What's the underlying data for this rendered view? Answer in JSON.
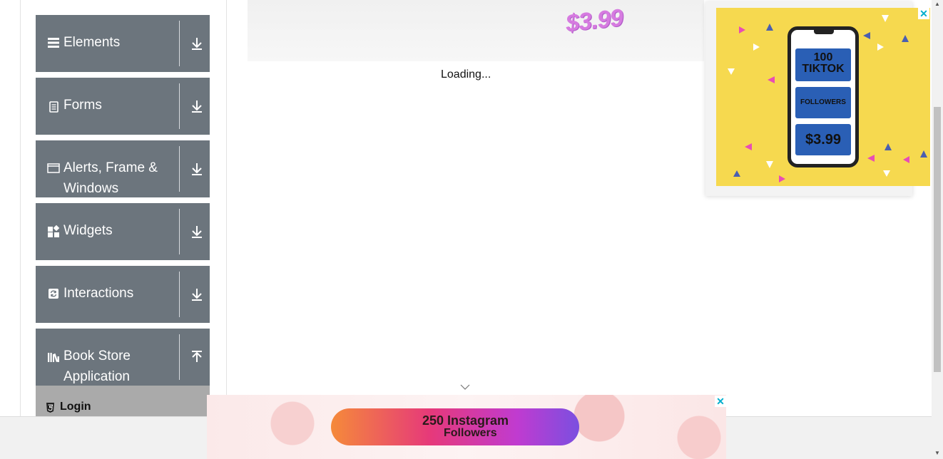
{
  "sidebar": {
    "groups": [
      {
        "label": "Elements",
        "icon": "menu-bars-icon",
        "toggle": "download-arrow-icon"
      },
      {
        "label": "Forms",
        "icon": "document-icon",
        "toggle": "download-arrow-icon"
      },
      {
        "label": "Alerts, Frame & Windows",
        "icon": "window-icon",
        "toggle": "download-arrow-icon"
      },
      {
        "label": "Widgets",
        "icon": "widgets-icon",
        "toggle": "download-arrow-icon"
      },
      {
        "label": "Interactions",
        "icon": "interactions-icon",
        "toggle": "download-arrow-icon"
      },
      {
        "label": "Book Store Application",
        "icon": "books-icon",
        "toggle": "upload-arrow-icon"
      }
    ],
    "active_subitem": {
      "label": "Login",
      "icon": "html5-icon"
    }
  },
  "main": {
    "banner_price": "$3.99",
    "loading_text": "Loading..."
  },
  "ad_right": {
    "box1": "100 TIKTOK",
    "box2": "FOLLOWERS",
    "box3": "$3.99",
    "close": "✕"
  },
  "ad_bottom": {
    "text_line1": "250 Instagram",
    "text_line2": "Followers",
    "close": "✕"
  },
  "colors": {
    "sidebar_group_bg": "#6c757d",
    "active_subitem_bg": "#aaaaaa",
    "ad_yellow": "#f6d94f",
    "ad_blue": "#2a5fb5",
    "close_cyan": "#00aecd"
  }
}
